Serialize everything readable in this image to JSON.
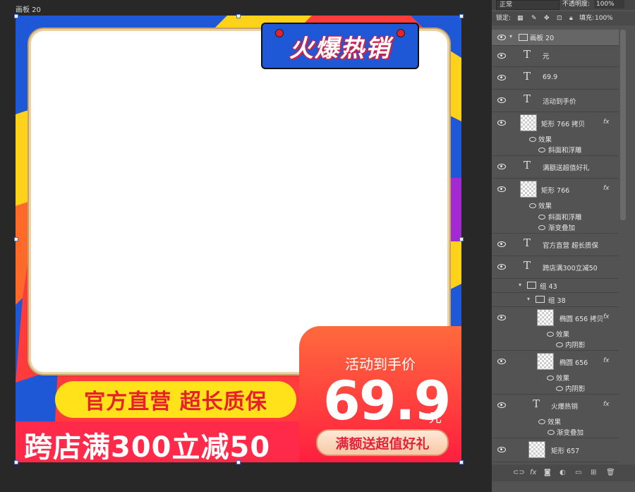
{
  "canvas": {
    "artboard_label": "画板 20"
  },
  "poster": {
    "hot_badge": "火爆热销",
    "activity_label": "活动到手价",
    "price": "69.9",
    "currency": "元",
    "gift_button": "满额送超值好礼",
    "yellow_banner": "官方直营 超长质保",
    "bottom_text": "跨店满300立减50"
  },
  "panel": {
    "blend_mode": "正常",
    "opacity_label": "不透明度:",
    "opacity_value": "100%",
    "lock_label": "锁定:",
    "fill_label": "填充:",
    "fill_value": "100%",
    "layers": [
      {
        "name": "画板 20"
      },
      {
        "name": "元"
      },
      {
        "name": "69.9"
      },
      {
        "name": "活动到手价"
      },
      {
        "name": "矩形 766 拷贝",
        "fx": "fx",
        "effects_label": "效果",
        "effects": [
          "斜面和浮雕"
        ]
      },
      {
        "name": "满额送超值好礼"
      },
      {
        "name": "矩形 766",
        "fx": "fx",
        "effects_label": "效果",
        "effects": [
          "斜面和浮雕",
          "渐变叠加"
        ]
      },
      {
        "name": "官方直营 超长质保"
      },
      {
        "name": "跨店满300立减50"
      },
      {
        "name": "组 43"
      },
      {
        "name": "组 38"
      },
      {
        "name": "椭圆 656 拷贝",
        "fx": "fx",
        "effects_label": "效果",
        "effects": [
          "内阴影"
        ]
      },
      {
        "name": "椭圆 656",
        "fx": "fx",
        "effects_label": "效果",
        "effects": [
          "内阴影"
        ]
      },
      {
        "name": "火爆热销",
        "fx": "fx",
        "effects_label": "效果",
        "effects": [
          "渐变叠加"
        ]
      },
      {
        "name": "矩形 657"
      }
    ]
  },
  "colors": {
    "artboard_red": "#ff3b3b",
    "badge_blue": "#1e58d6",
    "banner_yellow": "#ffe21a",
    "panel_bg": "#535353"
  }
}
